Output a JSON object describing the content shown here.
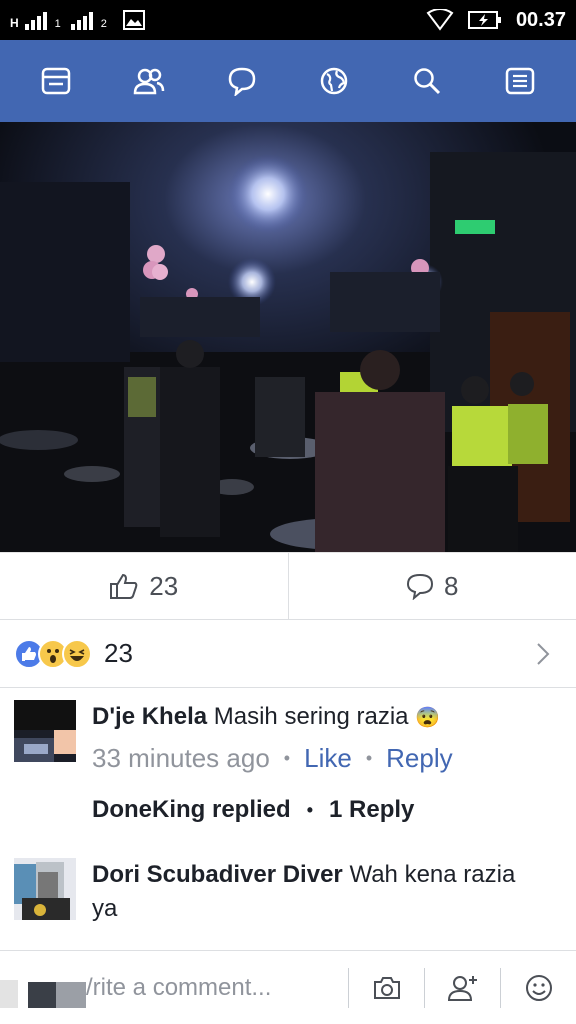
{
  "status_bar": {
    "sim1_label": "1",
    "sim2_label": "2",
    "network_type": "H",
    "time": "00.37"
  },
  "navbar": {
    "icons": [
      "news-feed-icon",
      "friends-icon",
      "messages-icon",
      "notifications-globe-icon",
      "search-icon",
      "menu-icon"
    ],
    "color": "#4267b2"
  },
  "post": {
    "like_count": "23",
    "comment_count": "8"
  },
  "reactions": {
    "count": "23",
    "types": [
      "like-reaction-icon",
      "wow-reaction-icon",
      "haha-reaction-icon"
    ]
  },
  "comments": [
    {
      "name": "D'je Khela",
      "text": "Masih sering razia",
      "emoji": "😨",
      "time": "33 minutes ago",
      "like_label": "Like",
      "reply_label": "Reply"
    },
    {
      "name": "Dori Scubadiver Diver",
      "text_line1": "Wah kena razia",
      "text_line2": "ya"
    }
  ],
  "reply_summary": {
    "replier": "DoneKing replied",
    "count_label": "1 Reply"
  },
  "composer": {
    "placeholder": "Write a comment...",
    "visible_text": "/rite a comment..."
  }
}
